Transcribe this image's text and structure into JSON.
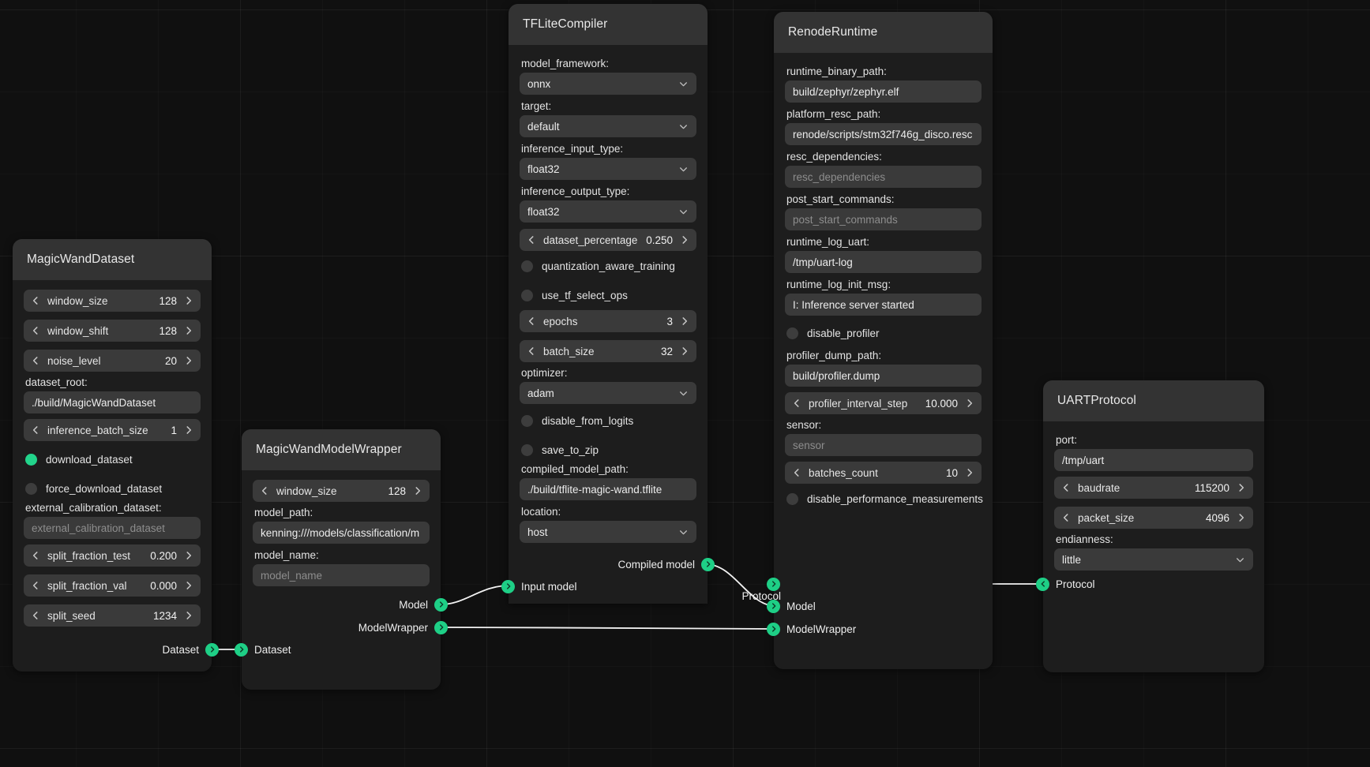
{
  "theme": {
    "accent": "#1ecf86",
    "node_bg": "#1d1d1d",
    "header_bg": "#333333",
    "field_bg": "#3a3a3a",
    "canvas_bg": "#101010"
  },
  "nodes": {
    "dataset": {
      "title": "MagicWandDataset",
      "steppers": [
        {
          "name": "window_size",
          "value": "128"
        },
        {
          "name": "window_shift",
          "value": "128"
        },
        {
          "name": "noise_level",
          "value": "20"
        }
      ],
      "dataset_root_label": "dataset_root:",
      "dataset_root_value": "./build/MagicWandDataset",
      "inference_batch_size": {
        "name": "inference_batch_size",
        "value": "1"
      },
      "download_dataset": "download_dataset",
      "force_download_dataset": "force_download_dataset",
      "external_calibration_label": "external_calibration_dataset:",
      "external_calibration_placeholder": "external_calibration_dataset",
      "split_fraction_test": {
        "name": "split_fraction_test",
        "value": "0.200"
      },
      "split_fraction_val": {
        "name": "split_fraction_val",
        "value": "0.000"
      },
      "split_seed": {
        "name": "split_seed",
        "value": "1234"
      },
      "out_socket": "Dataset"
    },
    "modelwrapper": {
      "title": "MagicWandModelWrapper",
      "window_size": {
        "name": "window_size",
        "value": "128"
      },
      "model_path_label": "model_path:",
      "model_path_value": "kenning:///models/classification/m",
      "model_name_label": "model_name:",
      "model_name_placeholder": "model_name",
      "in_socket": "Dataset",
      "out_model": "Model",
      "out_modelwrapper": "ModelWrapper"
    },
    "compiler": {
      "title": "TFLiteCompiler",
      "model_framework_label": "model_framework:",
      "model_framework_value": "onnx",
      "target_label": "target:",
      "target_value": "default",
      "inference_input_type_label": "inference_input_type:",
      "inference_input_type_value": "float32",
      "inference_output_type_label": "inference_output_type:",
      "inference_output_type_value": "float32",
      "dataset_percentage": {
        "name": "dataset_percentage",
        "value": "0.250"
      },
      "quantization_aware_training": "quantization_aware_training",
      "use_tf_select_ops": "use_tf_select_ops",
      "epochs": {
        "name": "epochs",
        "value": "3"
      },
      "batch_size": {
        "name": "batch_size",
        "value": "32"
      },
      "optimizer_label": "optimizer:",
      "optimizer_value": "adam",
      "disable_from_logits": "disable_from_logits",
      "save_to_zip": "save_to_zip",
      "compiled_model_path_label": "compiled_model_path:",
      "compiled_model_path_value": "./build/tflite-magic-wand.tflite",
      "location_label": "location:",
      "location_value": "host",
      "out_compiled_model": "Compiled model",
      "in_input_model": "Input model"
    },
    "runtime": {
      "title": "RenodeRuntime",
      "runtime_binary_path_label": "runtime_binary_path:",
      "runtime_binary_path_value": "build/zephyr/zephyr.elf",
      "platform_resc_path_label": "platform_resc_path:",
      "platform_resc_path_value": "renode/scripts/stm32f746g_disco.resc",
      "resc_dependencies_label": "resc_dependencies:",
      "resc_dependencies_placeholder": "resc_dependencies",
      "post_start_commands_label": "post_start_commands:",
      "post_start_commands_placeholder": "post_start_commands",
      "runtime_log_uart_label": "runtime_log_uart:",
      "runtime_log_uart_value": "/tmp/uart-log",
      "runtime_log_init_msg_label": "runtime_log_init_msg:",
      "runtime_log_init_msg_value": "I: Inference server started",
      "disable_profiler": "disable_profiler",
      "profiler_dump_path_label": "profiler_dump_path:",
      "profiler_dump_path_value": "build/profiler.dump",
      "profiler_interval_step": {
        "name": "profiler_interval_step",
        "value": "10.000"
      },
      "sensor_label": "sensor:",
      "sensor_placeholder": "sensor",
      "batches_count": {
        "name": "batches_count",
        "value": "10"
      },
      "disable_performance_measurements": "disable_performance_measurements",
      "in_model": "Model",
      "in_modelwrapper": "ModelWrapper",
      "in_protocol": "Protocol"
    },
    "protocol": {
      "title": "UARTProtocol",
      "port_label": "port:",
      "port_value": "/tmp/uart",
      "baudrate": {
        "name": "baudrate",
        "value": "115200"
      },
      "packet_size": {
        "name": "packet_size",
        "value": "4096"
      },
      "endianness_label": "endianness:",
      "endianness_value": "little",
      "out_protocol": "Protocol"
    }
  }
}
